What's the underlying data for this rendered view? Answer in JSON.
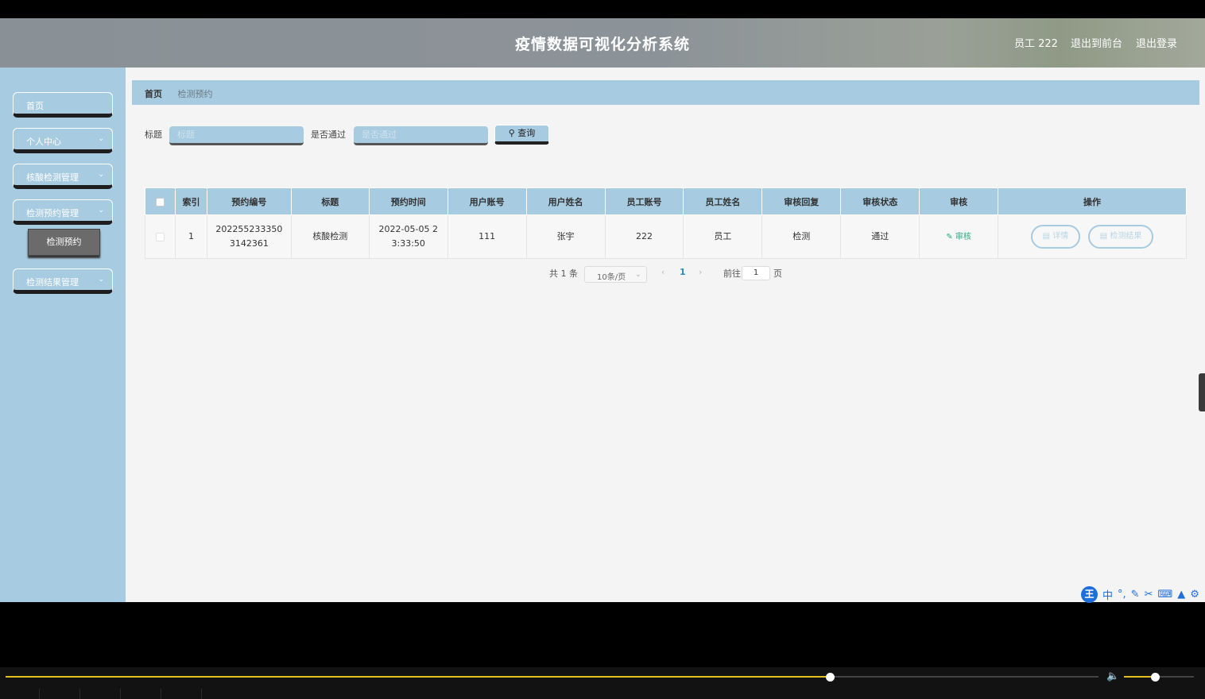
{
  "header": {
    "title": "疫情数据可视化分析系统",
    "user_label": "员工 222",
    "back_to_front": "退出到前台",
    "logout": "退出登录"
  },
  "sidebar": {
    "items": [
      {
        "label": "首页",
        "has_children": false
      },
      {
        "label": "个人中心",
        "has_children": true
      },
      {
        "label": "核酸检测管理",
        "has_children": true
      },
      {
        "label": "检测预约管理",
        "has_children": true
      },
      {
        "label": "检测结果管理",
        "has_children": true
      }
    ],
    "active_sub_item": "检测预约"
  },
  "breadcrumb": {
    "home": "首页",
    "current": "检测预约"
  },
  "search": {
    "title_label": "标题",
    "title_placeholder": "标题",
    "passed_label": "是否通过",
    "passed_placeholder": "是否通过",
    "query_button": "查询"
  },
  "table": {
    "columns": [
      "索引",
      "预约编号",
      "标题",
      "预约时间",
      "用户账号",
      "用户姓名",
      "员工账号",
      "员工姓名",
      "审核回复",
      "审核状态",
      "审核",
      "操作"
    ],
    "rows": [
      {
        "index": "1",
        "appointment_no": "2022552333503142361",
        "title": "核酸检测",
        "appointment_time": "2022-05-05 23:33:50",
        "user_account": "111",
        "user_name": "张宇",
        "staff_account": "222",
        "staff_name": "员工",
        "audit_reply": "检测",
        "audit_status": "通过",
        "audit_action": "审核",
        "op_detail": "详情",
        "op_result": "检测结果"
      }
    ]
  },
  "pagination": {
    "total_text": "共 1 条",
    "page_size": "10条/页",
    "current_page": "1",
    "goto_prefix": "前往",
    "goto_value": "1",
    "goto_suffix": "页"
  },
  "ime_toolbar": {
    "logo": "王",
    "mode": "中"
  },
  "player": {
    "progress": 0.754,
    "volume": 0.44
  },
  "colors": {
    "panel": "#a7cbe0",
    "audit_green": "#2aa87c",
    "progress": "#e3c11a"
  }
}
